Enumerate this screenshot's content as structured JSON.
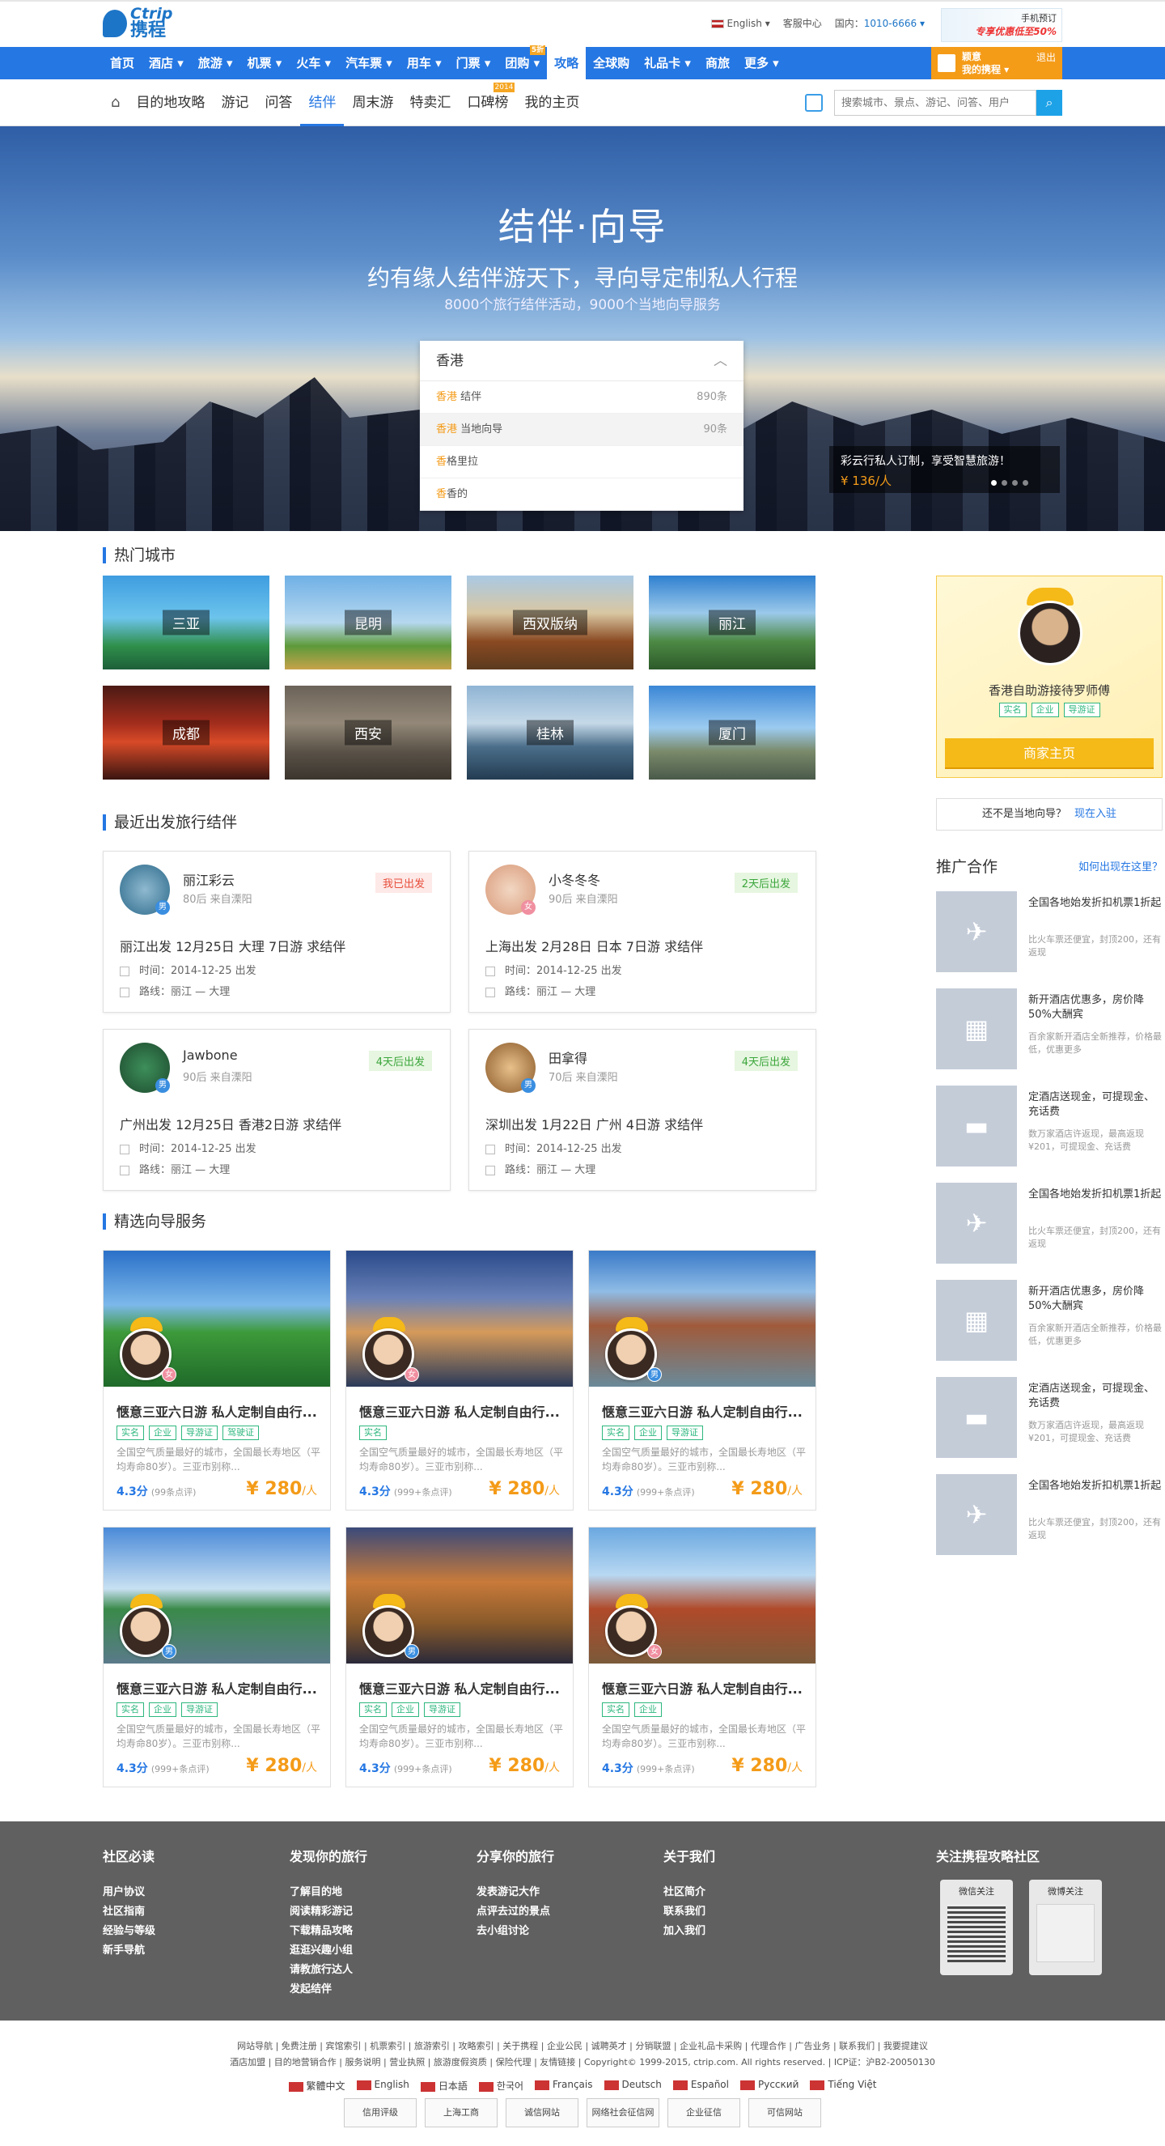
{
  "brand": {
    "en": "Ctrip",
    "cn": "携程"
  },
  "top": {
    "lang": "English ▾",
    "service": "客服中心",
    "phone_label": "国内：",
    "phone": "1010-6666 ▾"
  },
  "app_ad": {
    "line1": "手机预订",
    "line2": "专享优惠低至",
    "pct": "50%"
  },
  "main_nav": [
    {
      "label": "首页"
    },
    {
      "label": "酒店 ▾"
    },
    {
      "label": "旅游 ▾"
    },
    {
      "label": "机票 ▾"
    },
    {
      "label": "火车 ▾"
    },
    {
      "label": "汽车票 ▾"
    },
    {
      "label": "用车 ▾"
    },
    {
      "label": "门票 ▾"
    },
    {
      "label": "团购 ▾",
      "tag": "5折"
    },
    {
      "label": "攻略",
      "active": true
    },
    {
      "label": "全球购"
    },
    {
      "label": "礼品卡 ▾"
    },
    {
      "label": "商旅"
    },
    {
      "label": "更多 ▾"
    }
  ],
  "user": {
    "name": "颖意",
    "trips": "我的携程 ▾",
    "logout": "退出"
  },
  "sub_nav": [
    {
      "label": "目的地攻略"
    },
    {
      "label": "游记"
    },
    {
      "label": "问答"
    },
    {
      "label": "结伴",
      "active": true
    },
    {
      "label": "周末游"
    },
    {
      "label": "特卖汇"
    },
    {
      "label": "口碑榜",
      "tag": "2014"
    },
    {
      "label": "我的主页"
    }
  ],
  "search": {
    "placeholder": "搜索城市、景点、游记、问答、用户",
    "button": "⌕"
  },
  "hero": {
    "title": "结伴·向导",
    "subtitle": "约有缘人结伴游天下，寻向导定制私人行程",
    "stats": "8000个旅行结伴活动，9000个当地向导服务",
    "dropdown": {
      "value": "香港",
      "rows": [
        {
          "key": "香港",
          "rest": " 结伴",
          "count": "890条"
        },
        {
          "key": "香港",
          "rest": " 当地向导",
          "count": "90条"
        },
        {
          "key": "香",
          "rest": "格里拉",
          "count": ""
        },
        {
          "key": "香",
          "rest": "香的",
          "count": ""
        }
      ]
    },
    "promo": {
      "text": "彩云行私人订制，享受智慧旅游！",
      "price": "¥ 136/人"
    }
  },
  "hot_cities": {
    "title": "热门城市",
    "items": [
      {
        "name": "三亚"
      },
      {
        "name": "昆明"
      },
      {
        "name": "西双版纳"
      },
      {
        "name": "丽江"
      },
      {
        "name": "成都"
      },
      {
        "name": "西安"
      },
      {
        "name": "桂林"
      },
      {
        "name": "厦门"
      }
    ]
  },
  "featured_guide": {
    "name": "香港自助游接待罗师傅",
    "badges": [
      "实名",
      "企业",
      "导游证"
    ],
    "button": "商家主页"
  },
  "not_local": {
    "text": "还不是当地向导？",
    "link": "现在入驻"
  },
  "companions": {
    "title": "最近出发旅行结伴",
    "items": [
      {
        "user": "丽江彩云",
        "info": "80后 来自溧阳",
        "sex": "男",
        "status": "我已出发",
        "state": "go",
        "title": "丽江出发 12月25日 大理 7日游 求结伴",
        "time": "时间：2014-12-25 出发",
        "route": "路线：丽江 — 大理"
      },
      {
        "user": "小冬冬冬",
        "info": "90后 来自溧阳",
        "sex": "女",
        "status": "2天后出发",
        "state": "soon",
        "title": "上海出发 2月28日 日本 7日游 求结伴",
        "time": "时间：2014-12-25 出发",
        "route": "路线：丽江 — 大理"
      },
      {
        "user": "Jawbone",
        "info": "90后 来自溧阳",
        "sex": "男",
        "status": "4天后出发",
        "state": "soon",
        "title": "广州出发 12月25日 香港2日游 求结伴",
        "time": "时间：2014-12-25 出发",
        "route": "路线：丽江 — 大理"
      },
      {
        "user": "田拿得",
        "info": "70后 来自溧阳",
        "sex": "男",
        "status": "4天后出发",
        "state": "soon",
        "title": "深圳出发 1月22日 广州 4日游 求结伴",
        "time": "时间：2014-12-25 出发",
        "route": "路线：丽江 — 大理"
      }
    ]
  },
  "services": {
    "title": "精选向导服务",
    "items": [
      {
        "title": "惬意三亚六日游 私人定制自由行...",
        "badges": [
          "实名",
          "企业",
          "导游证",
          "驾驶证"
        ],
        "sex": "女",
        "desc": "全国空气质量最好的城市，全国最长寿地区（平均寿命80岁）。三亚市别称...",
        "score": "4.3分",
        "reviews": "(99条点评)",
        "price": "¥ 280",
        "unit": "/人"
      },
      {
        "title": "惬意三亚六日游 私人定制自由行...",
        "badges": [
          "实名"
        ],
        "sex": "女",
        "desc": "全国空气质量最好的城市，全国最长寿地区（平均寿命80岁）。三亚市别称...",
        "score": "4.3分",
        "reviews": "(999+条点评)",
        "price": "¥ 280",
        "unit": "/人"
      },
      {
        "title": "惬意三亚六日游 私人定制自由行...",
        "badges": [
          "实名",
          "企业",
          "导游证"
        ],
        "sex": "男",
        "desc": "全国空气质量最好的城市，全国最长寿地区（平均寿命80岁）。三亚市别称...",
        "score": "4.3分",
        "reviews": "(999+条点评)",
        "price": "¥ 280",
        "unit": "/人"
      },
      {
        "title": "惬意三亚六日游 私人定制自由行...",
        "badges": [
          "实名",
          "企业",
          "导游证"
        ],
        "sex": "男",
        "desc": "全国空气质量最好的城市，全国最长寿地区（平均寿命80岁）。三亚市别称...",
        "score": "4.3分",
        "reviews": "(999+条点评)",
        "price": "¥ 280",
        "unit": "/人"
      },
      {
        "title": "惬意三亚六日游 私人定制自由行...",
        "badges": [
          "实名",
          "企业",
          "导游证"
        ],
        "sex": "男",
        "desc": "全国空气质量最好的城市，全国最长寿地区（平均寿命80岁）。三亚市别称...",
        "score": "4.3分",
        "reviews": "(999+条点评)",
        "price": "¥ 280",
        "unit": "/人"
      },
      {
        "title": "惬意三亚六日游 私人定制自由行...",
        "badges": [
          "实名",
          "企业"
        ],
        "sex": "女",
        "desc": "全国空气质量最好的城市，全国最长寿地区（平均寿命80岁）。三亚市别称...",
        "score": "4.3分",
        "reviews": "(999+条点评)",
        "price": "¥ 280",
        "unit": "/人"
      }
    ]
  },
  "ads": {
    "title": "推广合作",
    "link": "如何出现在这里？",
    "items": [
      {
        "icon": "plane-icon",
        "head": "全国各地始发折扣机票1折起",
        "desc": "比火车票还便宜，封顶200，还有返现"
      },
      {
        "icon": "hotel-icon",
        "head": "新开酒店优惠多，房价降50%大酬宾",
        "desc": "百余家新开酒店全新推荐，价格最低，优惠更多"
      },
      {
        "icon": "bed-icon",
        "head": "定酒店送现金，可提现金、充话费",
        "desc": "数万家酒店许返现，最高返现¥201，可提现金、充话费"
      },
      {
        "icon": "plane-icon",
        "head": "全国各地始发折扣机票1折起",
        "desc": "比火车票还便宜，封顶200，还有返现"
      },
      {
        "icon": "hotel-icon",
        "head": "新开酒店优惠多，房价降50%大酬宾",
        "desc": "百余家新开酒店全新推荐，价格最低，优惠更多"
      },
      {
        "icon": "bed-icon",
        "head": "定酒店送现金，可提现金、充话费",
        "desc": "数万家酒店许返现，最高返现¥201，可提现金、充话费"
      },
      {
        "icon": "plane-icon",
        "head": "全国各地始发折扣机票1折起",
        "desc": "比火车票还便宜，封顶200，还有返现"
      }
    ]
  },
  "footer": {
    "cols": [
      {
        "title": "社区必读",
        "links": [
          "用户协议",
          "社区指南",
          "经验与等级",
          "新手导航"
        ]
      },
      {
        "title": "发现你的旅行",
        "links": [
          "了解目的地",
          "阅读精彩游记",
          "下载精品攻略",
          "逛逛兴趣小组",
          "请教旅行达人",
          "发起结伴"
        ]
      },
      {
        "title": "分享你的旅行",
        "links": [
          "发表游记大作",
          "点评去过的景点",
          "去小组讨论"
        ]
      },
      {
        "title": "关于我们",
        "links": [
          "社区简介",
          "联系我们",
          "加入我们"
        ]
      }
    ],
    "follow_title": "关注携程攻略社区",
    "wechat": "微信关注",
    "weibo": "微博关注",
    "links1": "网站导航 | 免费注册 | 宾馆索引 | 机票索引 | 旅游索引 | 攻略索引 | 关于携程 | 企业公民 | 诚聘英才 | 分销联盟 | 企业礼品卡采购 | 代理合作 | 广告业务 | 联系我们 | 我要提建议",
    "links2": "酒店加盟 | 目的地营销合作 | 服务说明 | 营业执照 | 旅游度假资质 | 保险代理 | 友情链接 | Copyright© 1999-2015, ctrip.com. All rights reserved. | ICP证：沪B2-20050130",
    "langs": [
      "繁體中文",
      "English",
      "日本語",
      "한국어",
      "Français",
      "Deutsch",
      "Español",
      "Русский",
      "Tiếng Việt"
    ],
    "certs": [
      "信用评级",
      "上海工商",
      "诚信网站",
      "网络社会征信网",
      "企业征信",
      "可信网站"
    ]
  }
}
